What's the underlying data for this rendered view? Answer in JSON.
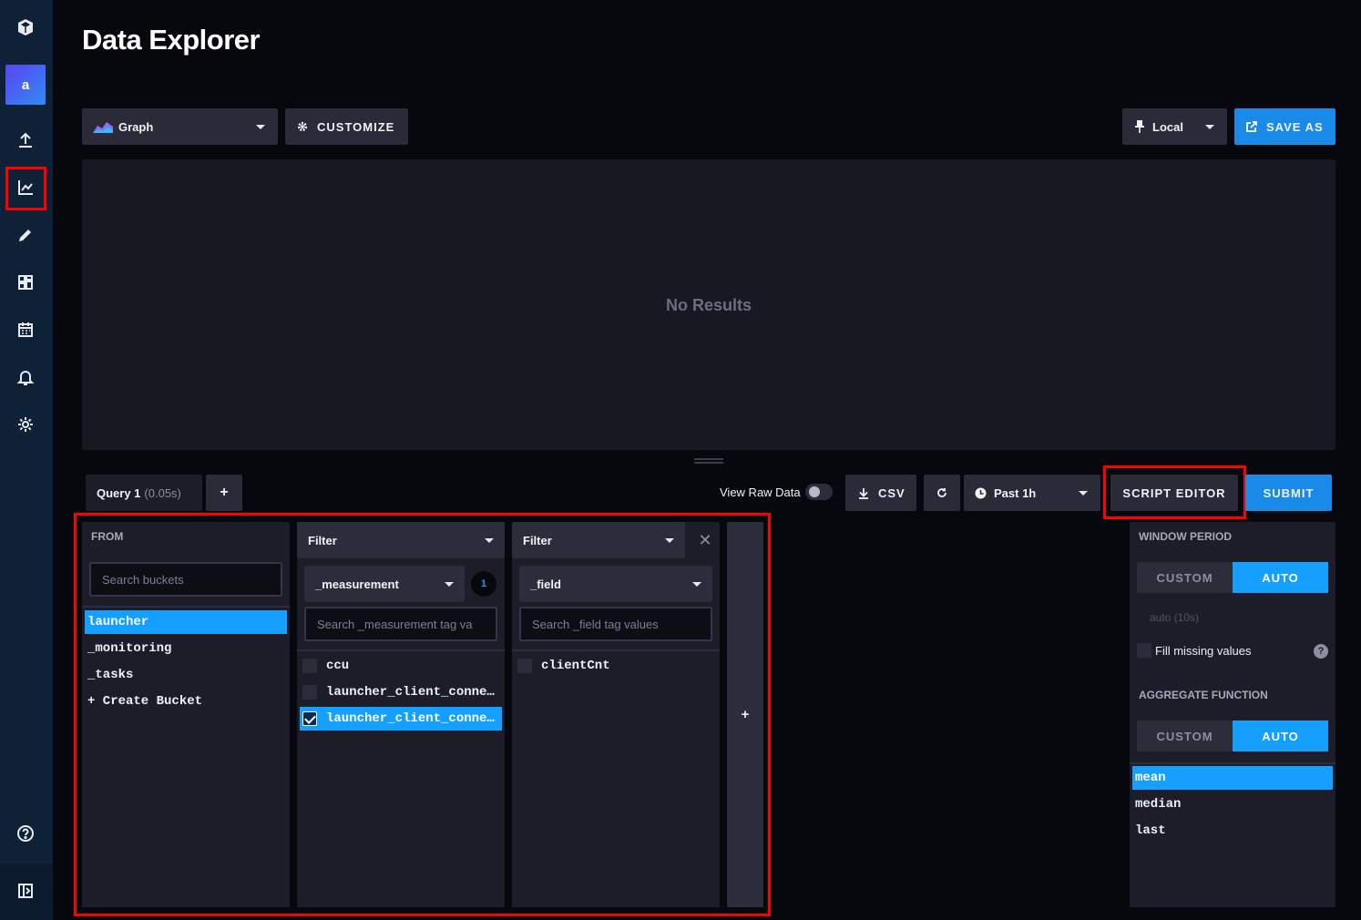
{
  "page": {
    "title": "Data Explorer"
  },
  "sidebar": {
    "org_initial": "a",
    "items": [
      {
        "name": "logo-icon"
      },
      {
        "name": "upload-icon",
        "label": "Load Data"
      },
      {
        "name": "graph-icon",
        "label": "Data Explorer",
        "active": true
      },
      {
        "name": "pencil-icon",
        "label": "Notebooks"
      },
      {
        "name": "dashboards-icon",
        "label": "Dashboards"
      },
      {
        "name": "calendar-icon",
        "label": "Tasks"
      },
      {
        "name": "bell-icon",
        "label": "Alerts"
      },
      {
        "name": "gear-icon",
        "label": "Settings"
      },
      {
        "name": "help-icon",
        "label": "Help"
      },
      {
        "name": "collapse-icon",
        "label": "Collapse"
      }
    ]
  },
  "toolbar": {
    "graph_type": "Graph",
    "customize_label": "CUSTOMIZE",
    "timezone": "Local",
    "save_as_label": "SAVE AS"
  },
  "graph": {
    "empty_text": "No Results"
  },
  "query": {
    "tab_label": "Query 1",
    "tab_time": "(0.05s)",
    "add_label": "+",
    "view_raw_label": "View Raw Data",
    "csv_label": "CSV",
    "time_range": "Past 1h",
    "script_editor_label": "SCRIPT EDITOR",
    "submit_label": "SUBMIT"
  },
  "from": {
    "header": "FROM",
    "search_placeholder": "Search buckets",
    "buckets": [
      "launcher",
      "_monitoring",
      "_tasks",
      "+ Create Bucket"
    ],
    "selected": "launcher"
  },
  "filter1": {
    "header": "Filter",
    "key": "_measurement",
    "count": "1",
    "search_placeholder": "Search _measurement tag va",
    "values": [
      {
        "label": "ccu",
        "checked": false
      },
      {
        "label": "launcher_client_conne…",
        "checked": false
      },
      {
        "label": "launcher_client_conne…",
        "checked": true
      }
    ]
  },
  "filter2": {
    "header": "Filter",
    "key": "_field",
    "search_placeholder": "Search _field tag values",
    "values": [
      {
        "label": "clientCnt",
        "checked": false
      }
    ]
  },
  "add_filter_label": "+",
  "aggregate": {
    "window_header": "WINDOW PERIOD",
    "custom_label": "CUSTOM",
    "auto_label": "AUTO",
    "auto_value": "auto (10s)",
    "fill_missing_label": "Fill missing values",
    "function_header": "AGGREGATE FUNCTION",
    "functions": [
      "mean",
      "median",
      "last"
    ],
    "selected_function": "mean"
  },
  "colors": {
    "accent": "#15a0ff",
    "sidebar": "#0f2136",
    "panel": "#1c1d28",
    "highlight_box": "#ff0000"
  }
}
